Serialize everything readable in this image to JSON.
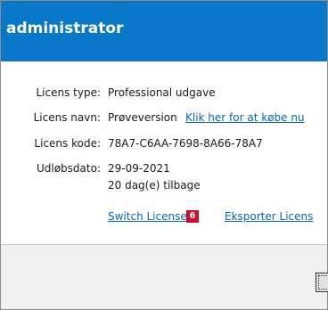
{
  "header": {
    "title": "administrator",
    "background_color": "#0a78c9"
  },
  "license": {
    "type_label": "Licens type:",
    "type_value": "Professional udgave",
    "name_label": "Licens navn:",
    "name_value": "Prøveversion",
    "buy_link": "Klik her for at købe nu",
    "code_label": "Licens kode:",
    "code_value": "78A7-C6AA-7698-8A66-78A7",
    "expiry_label": "Udløbsdato:",
    "expiry_value": "29-09-2021",
    "days_left": "20 dag(e) tilbage"
  },
  "actions": {
    "switch_license": "Switch License",
    "badge": "6",
    "badge_color": "#c8102e",
    "export_license": "Eksporter Licens",
    "link_color": "#0a64c0"
  }
}
